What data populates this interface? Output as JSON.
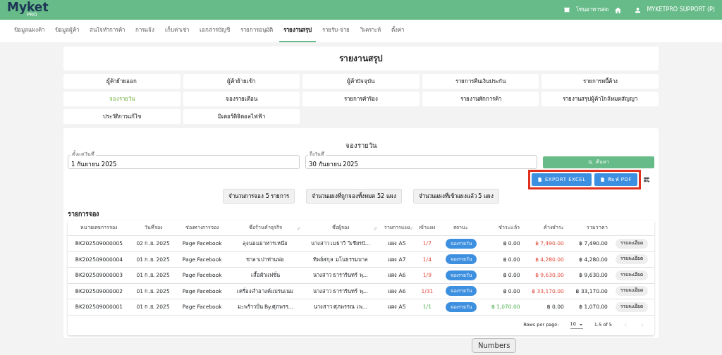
{
  "header": {
    "logo": "Myket",
    "logo_sub": "PRO",
    "zone": "โซนอาหารสด",
    "user": "MYKETPRO SUPPORT (P)"
  },
  "tabs": [
    {
      "label": "ข้อมูลแผงค้า",
      "selected": false
    },
    {
      "label": "ข้อมูลผู้ค้า",
      "selected": false
    },
    {
      "label": "สนใจทำการค้า",
      "selected": false
    },
    {
      "label": "การแจ้ง",
      "selected": false
    },
    {
      "label": "เก็บค่าเช่า",
      "selected": false
    },
    {
      "label": "เอกสารบัญชี",
      "selected": false
    },
    {
      "label": "รายการอนุมัติ",
      "selected": false
    },
    {
      "label": "รายงานสรุป",
      "selected": true
    },
    {
      "label": "รายรับ-จ่าย",
      "selected": false
    },
    {
      "label": "วิเคราะห์",
      "selected": false
    },
    {
      "label": "ตั้งค่า",
      "selected": false
    }
  ],
  "page_title": "รายงานสรุป",
  "reports": [
    {
      "label": "ผู้ค้าย้ายออก",
      "selected": false
    },
    {
      "label": "ผู้ค้าย้ายเข้า",
      "selected": false
    },
    {
      "label": "ผู้ค้าปัจจุบัน",
      "selected": false
    },
    {
      "label": "รายการคืนเงินประกัน",
      "selected": false
    },
    {
      "label": "รายการหนี้ค้าง",
      "selected": false
    },
    {
      "label": "จองรายวัน",
      "selected": true
    },
    {
      "label": "จองรายเดือน",
      "selected": false
    },
    {
      "label": "รายการคำร้อง",
      "selected": false
    },
    {
      "label": "รายงานพักการค้า",
      "selected": false
    },
    {
      "label": "รายงานสรุปผู้ค้าใกล้หมดสัญญา",
      "selected": false
    },
    {
      "label": "ประวัติการแก้ไข",
      "selected": false
    },
    {
      "label": "มิเตอร์ดิจิตอลไฟฟ้า",
      "selected": false
    }
  ],
  "filter": {
    "title": "จองรายวัน",
    "from_label": "ตั้งแต่วันที่",
    "from_value": "1 กันยายน 2025",
    "to_label": "ถึงวันที่",
    "to_value": "30 กันยายน 2025",
    "search": "ค้นหา",
    "export_excel": "EXPORT EXCEL",
    "export_pdf": "พิมพ์ PDF"
  },
  "summary": [
    "จำนวนการจอง 5 รายการ",
    "จำนวนแผงที่ถูกจองทั้งหมด 52 แผง",
    "จำนวนแผงที่เข้าแผงแล้ว 5 แผง"
  ],
  "table": {
    "title": "รายการจอง",
    "columns": [
      {
        "label": "หมายเลขการจอง",
        "resizable": false
      },
      {
        "label": "วันที่จอง",
        "resizable": false
      },
      {
        "label": "ช่องทางการจอง",
        "resizable": false
      },
      {
        "label": "ชื่อร้านค้าธุรกิจ",
        "resizable": true
      },
      {
        "label": "ชื่อผู้จอง",
        "resizable": true
      },
      {
        "label": "รายการแผง",
        "resizable": true
      },
      {
        "label": "เข้าแผง",
        "resizable": false
      },
      {
        "label": "สถานะ",
        "resizable": false
      },
      {
        "label": "ชำระแล้ว",
        "resizable": false
      },
      {
        "label": "ค้างชำระ",
        "resizable": false
      },
      {
        "label": "รวมราคา",
        "resizable": false
      }
    ],
    "rows": [
      {
        "id": "BK202509000005",
        "date": "02 ก.ย. 2025",
        "channel": "Page Facebook",
        "shop": "ลุงนอมอาหารเหนือ",
        "booker": "นางสาว เมธาวี วิเชียรปั...",
        "stall": "แผง A5",
        "entry": "1/7",
        "status": "จองรายวัน",
        "paid": "฿ 0.00",
        "due": "฿ 7,490.00",
        "total": "฿ 7,490.00",
        "action": "รายละเอียด",
        "settled": false
      },
      {
        "id": "BK202509000004",
        "date": "01 ก.ย. 2025",
        "channel": "Page Facebook",
        "shop": "ชาลาเปาท่านพ่อ",
        "booker": "ทิพย์สกุล มโนธรรมบาล",
        "stall": "แผง A7",
        "entry": "1/4",
        "status": "จองรายวัน",
        "paid": "฿ 0.00",
        "due": "฿ 4,280.00",
        "total": "฿ 4,280.00",
        "action": "รายละเอียด",
        "settled": false
      },
      {
        "id": "BK202509000003",
        "date": "01 ก.ย. 2025",
        "channel": "Page Facebook",
        "shop": "เสื้อผ้าแฟชั่น",
        "booker": "นางสาว ธารารินทร์ พุ...",
        "stall": "แผง A6",
        "entry": "1/9",
        "status": "จองรายวัน",
        "paid": "฿ 0.00",
        "due": "฿ 9,630.00",
        "total": "฿ 9,630.00",
        "action": "รายละเอียด",
        "settled": false
      },
      {
        "id": "BK202509000002",
        "date": "01 ก.ย. 2025",
        "channel": "Page Facebook",
        "shop": "เครื่องสำอางค์แบรนเนม",
        "booker": "นางสาว ธารารินทร์ พุ...",
        "stall": "แผง A6",
        "entry": "1/31",
        "status": "จองรายวัน",
        "paid": "฿ 0.00",
        "due": "฿ 33,170.00",
        "total": "฿ 33,170.00",
        "action": "รายละเอียด",
        "settled": false
      },
      {
        "id": "BK202509000001",
        "date": "01 ก.ย. 2025",
        "channel": "Page Facebook",
        "shop": "มะพร้าวปั่น By.ศุภพรร...",
        "booker": "นางสาว ศุภพรรณ เพ...",
        "stall": "แผง A5",
        "entry": "1/1",
        "status": "จองรายวัน",
        "paid": "฿ 1,070.00",
        "due": "฿ 0.00",
        "total": "฿ 1,070.00",
        "action": "รายละเอียด",
        "settled": true
      }
    ],
    "pagination": {
      "rows_label": "Rows per page:",
      "rows_value": "10",
      "range": "1-5 of 5"
    }
  },
  "tooltip": "Numbers"
}
